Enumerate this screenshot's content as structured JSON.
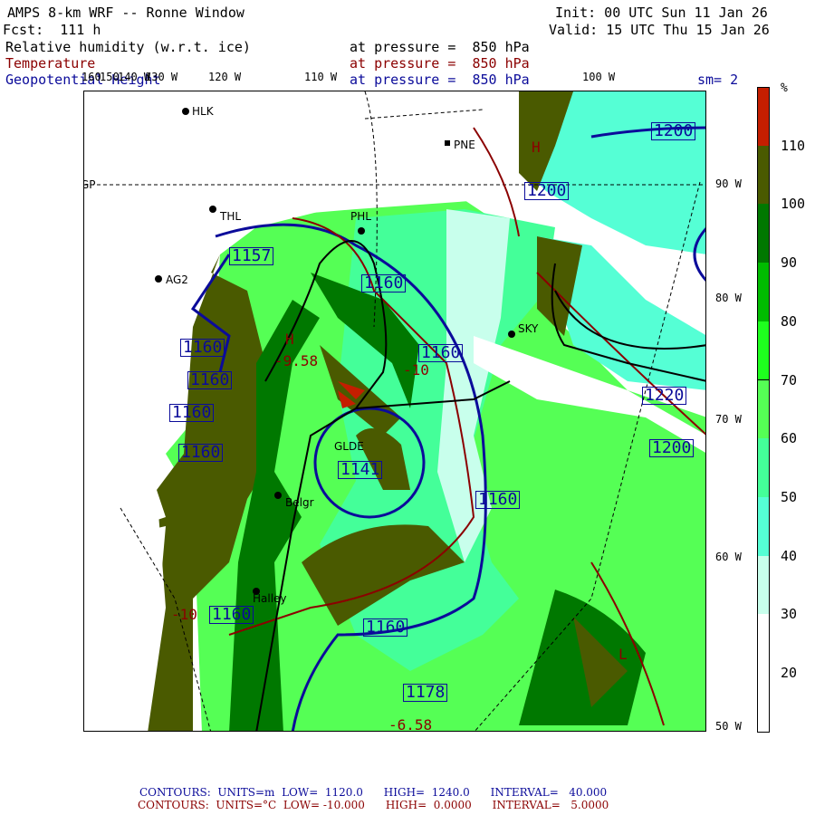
{
  "header": {
    "title": "AMPS 8-km WRF -- Ronne Window",
    "init": "Init: 00 UTC Sun 11 Jan 26",
    "fcst": "Fcst:  111 h",
    "valid": "Valid: 15 UTC Thu 15 Jan 26"
  },
  "fields": [
    {
      "name": "Relative humidity (w.r.t. ice)",
      "level": "at pressure =  850 hPa"
    },
    {
      "name": "Temperature",
      "level": "at pressure =  850 hPa"
    },
    {
      "name": "Geopotential Height",
      "level": "at pressure =  850 hPa"
    }
  ],
  "smoothing": "sm= 2",
  "lon_labels": [
    "160",
    "150",
    "140 W",
    "130 W",
    "120 W",
    "110 W",
    "100 W"
  ],
  "lat_labels": [
    "90 W",
    "80 W",
    "70 W",
    "60 W",
    "50 W"
  ],
  "colorbar": {
    "unit": "%",
    "labels": [
      "110",
      "100",
      "90",
      "80",
      "70",
      "60",
      "50",
      "40",
      "30",
      "20"
    ],
    "colors": [
      "#c41e00",
      "#4a5a00",
      "#007800",
      "#00bb00",
      "#1eff1e",
      "#55ff55",
      "#44ff99",
      "#55ffd5",
      "#c8ffec",
      "#ffffff",
      "#ffffff"
    ]
  },
  "stations": [
    "HLK",
    "PNE",
    "THL",
    "PHL",
    "AG2",
    "SKY",
    "GLDE",
    "Belgr",
    "Halley",
    "GP"
  ],
  "height_labels": [
    "1157",
    "1160",
    "1160",
    "1160",
    "1160",
    "1160",
    "1160",
    "1160",
    "1160",
    "1141",
    "1200",
    "1200",
    "1220",
    "1200",
    "1178",
    "1160"
  ],
  "temp_labels": [
    "-9.58",
    "-10",
    "H",
    "L",
    "H",
    "-10",
    "-6.58"
  ],
  "footer": {
    "height": {
      "label": "CONTOURS:",
      "units": "UNITS=m",
      "low": "LOW=  1120.0",
      "high": "HIGH=  1240.0",
      "interval": "INTERVAL=   40.000"
    },
    "temp": {
      "label": "CONTOURS:",
      "units": "UNITS=°C",
      "low": "LOW= -10.000",
      "high": "HIGH=  0.0000",
      "interval": "INTERVAL=   5.0000"
    }
  }
}
